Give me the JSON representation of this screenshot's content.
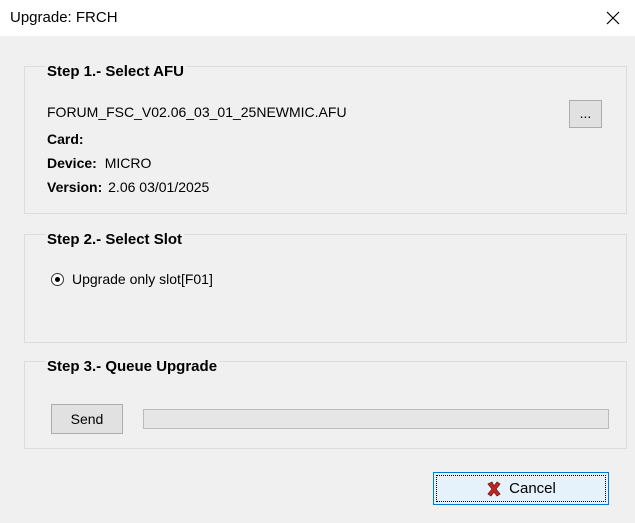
{
  "window": {
    "title": "Upgrade: FRCH"
  },
  "step1": {
    "title": "Step 1.- Select AFU",
    "file_name": "FORUM_FSC_V02.06_03_01_25NEWMIC.AFU",
    "browse_label": "...",
    "card_label": "Card:",
    "card_value": "",
    "device_label": "Device:",
    "device_value": "MICRO",
    "version_label": "Version:",
    "version_value": "2.06 03/01/2025"
  },
  "step2": {
    "title": "Step 2.- Select Slot",
    "radio_label": "Upgrade only slot[F01]",
    "radio_selected": true
  },
  "step3": {
    "title": "Step 3.- Queue Upgrade",
    "send_label": "Send",
    "progress": 0
  },
  "footer": {
    "cancel_label": "Cancel"
  },
  "colors": {
    "cancel_icon": "#c0281e",
    "progress_fill": "#06b025"
  },
  "icons": {
    "close": "close-icon",
    "cancel": "red-x-icon"
  }
}
